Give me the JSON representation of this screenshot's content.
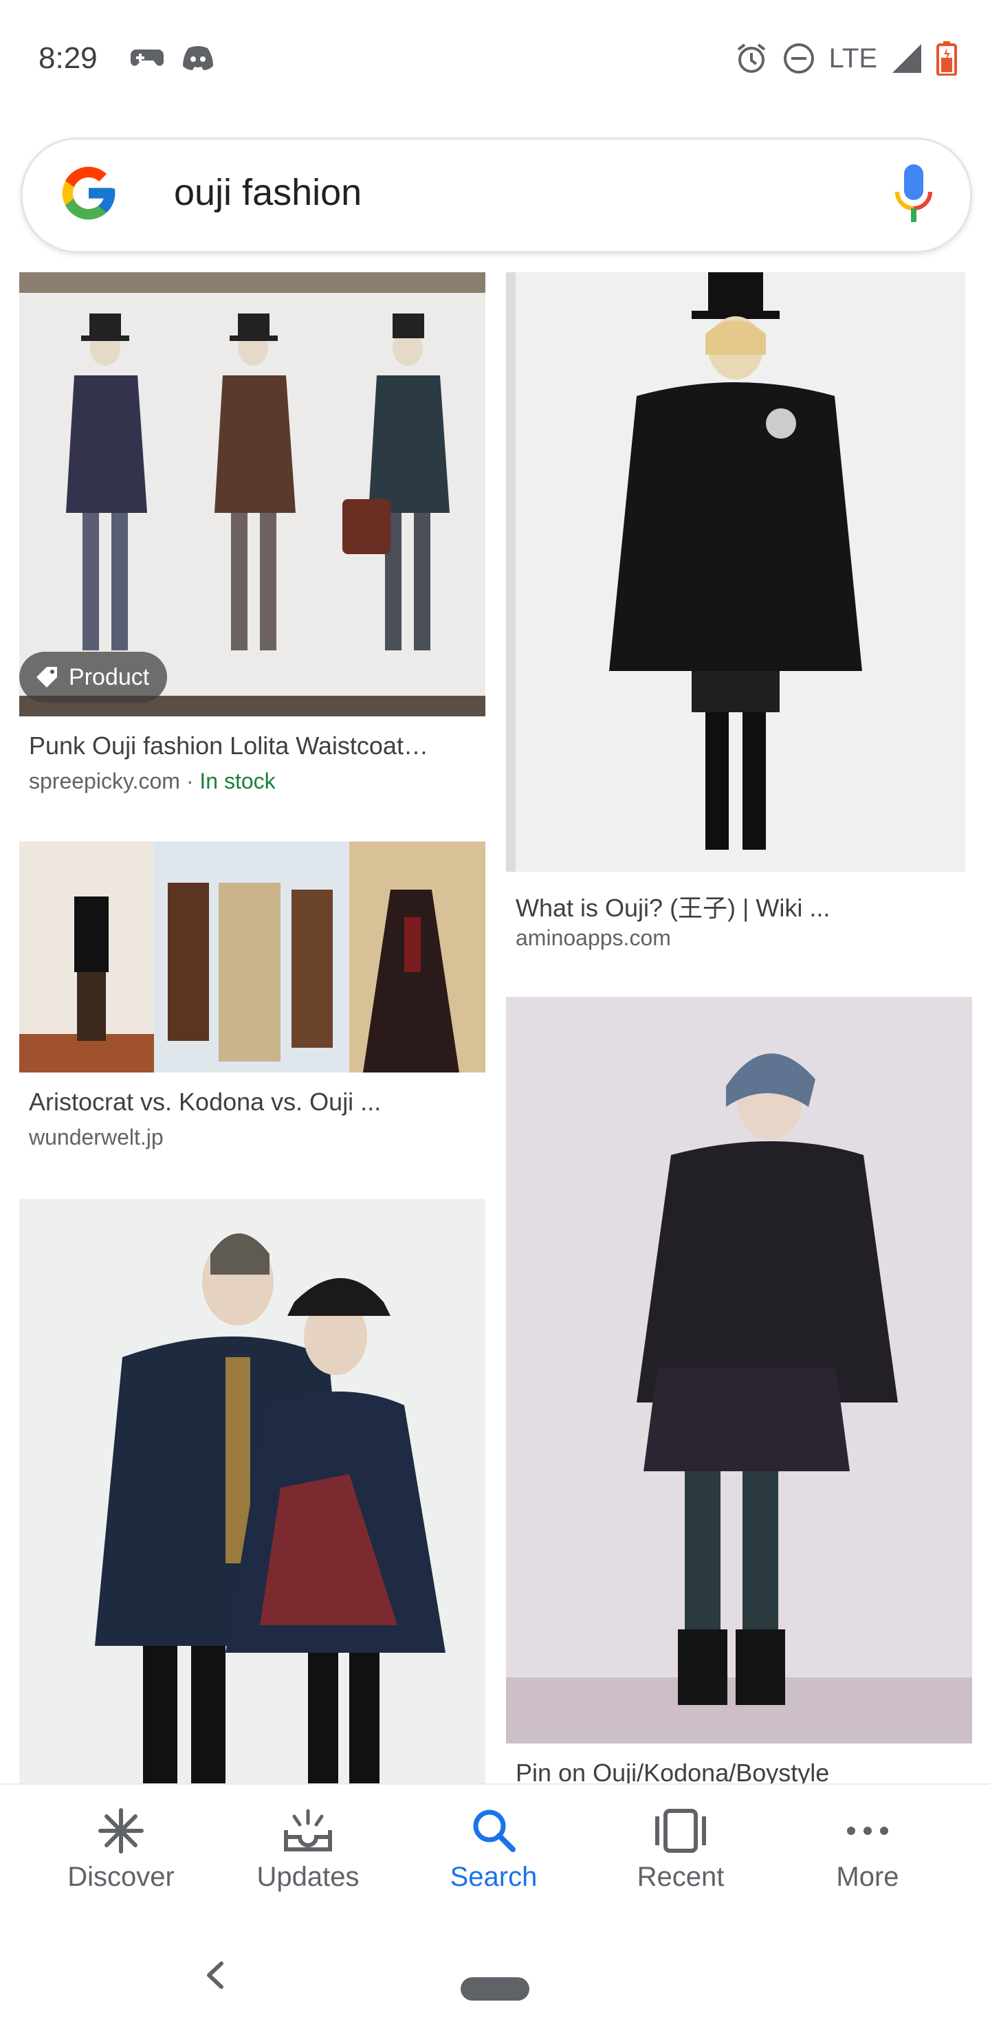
{
  "status_bar": {
    "time": "8:29",
    "network": "LTE",
    "left_icons": [
      "game-controller-icon",
      "discord-icon"
    ],
    "right_icons": [
      "alarm-icon",
      "do-not-disturb-icon",
      "signal-icon",
      "battery-icon"
    ]
  },
  "search": {
    "query": "ouji fashion",
    "logo": "google-g-logo",
    "mic_icon": "mic-icon"
  },
  "results": [
    {
      "title": "Punk Ouji fashion Lolita Waistcoat…",
      "source": "spreepicky.com",
      "separator": " · ",
      "stock": "In stock",
      "badge": "Product"
    },
    {
      "title": "What is Ouji? (王子) | Wiki ...",
      "source": "aminoapps.com"
    },
    {
      "title": "Aristocrat vs. Kodona vs. Ouji ...",
      "source": "wunderwelt.jp"
    },
    {
      "title": "Pin on Ouji/Kodona/Boystyle"
    }
  ],
  "bottom_nav": [
    {
      "label": "Discover",
      "icon": "asterisk-icon",
      "active": false
    },
    {
      "label": "Updates",
      "icon": "updates-tray-icon",
      "active": false
    },
    {
      "label": "Search",
      "icon": "search-icon",
      "active": true
    },
    {
      "label": "Recent",
      "icon": "recent-cards-icon",
      "active": false
    },
    {
      "label": "More",
      "icon": "more-dots-icon",
      "active": false
    }
  ],
  "colors": {
    "accent": "#1a73e8",
    "in_stock": "#188038",
    "nav_inactive": "#5f6368"
  }
}
